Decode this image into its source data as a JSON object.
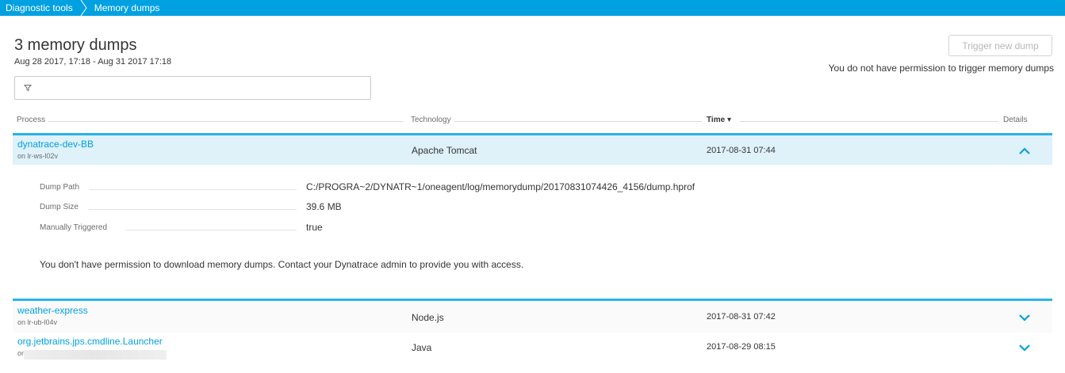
{
  "breadcrumb": {
    "items": [
      "Diagnostic tools",
      "Memory dumps"
    ]
  },
  "header": {
    "title": "3 memory dumps",
    "time_range": "Aug 28 2017, 17:18 - Aug 31 2017 17:18",
    "trigger_button": "Trigger new dump",
    "permission_note": "You do not have permission to trigger memory dumps"
  },
  "filter": {
    "icon": "filter-icon",
    "value": ""
  },
  "table": {
    "columns": [
      "Process",
      "Technology",
      "Time ▾",
      "Details"
    ],
    "sorted_column": "Time",
    "rows": [
      {
        "process": "dynatrace-dev-BB",
        "host": "on lr-ws-l02v",
        "technology": "Apache Tomcat",
        "time": "2017-08-31 07:44",
        "expanded": true,
        "details": {
          "labels": [
            "Dump Path",
            "Dump Size",
            "Manually Triggered"
          ],
          "values": [
            "C:/PROGRA~2/DYNATR~1/oneagent/log/memorydump/20170831074426_4156/dump.hprof",
            "39.6 MB",
            "true"
          ],
          "note": "You don't have permission to download memory dumps. Contact your Dynatrace admin to provide you with access."
        }
      },
      {
        "process": "weather-express",
        "host": "on lr-ub-l04v",
        "technology": "Node.js",
        "time": "2017-08-31 07:42",
        "expanded": false
      },
      {
        "process": "org.jetbrains.jps.cmdline.Launcher",
        "host": "on",
        "technology": "Java",
        "time": "2017-08-29 08:15",
        "expanded": false
      }
    ]
  },
  "colors": {
    "accent": "#00a1e0",
    "expanded_row_bg": "#dff1f9",
    "row_border": "#28b4e8"
  }
}
